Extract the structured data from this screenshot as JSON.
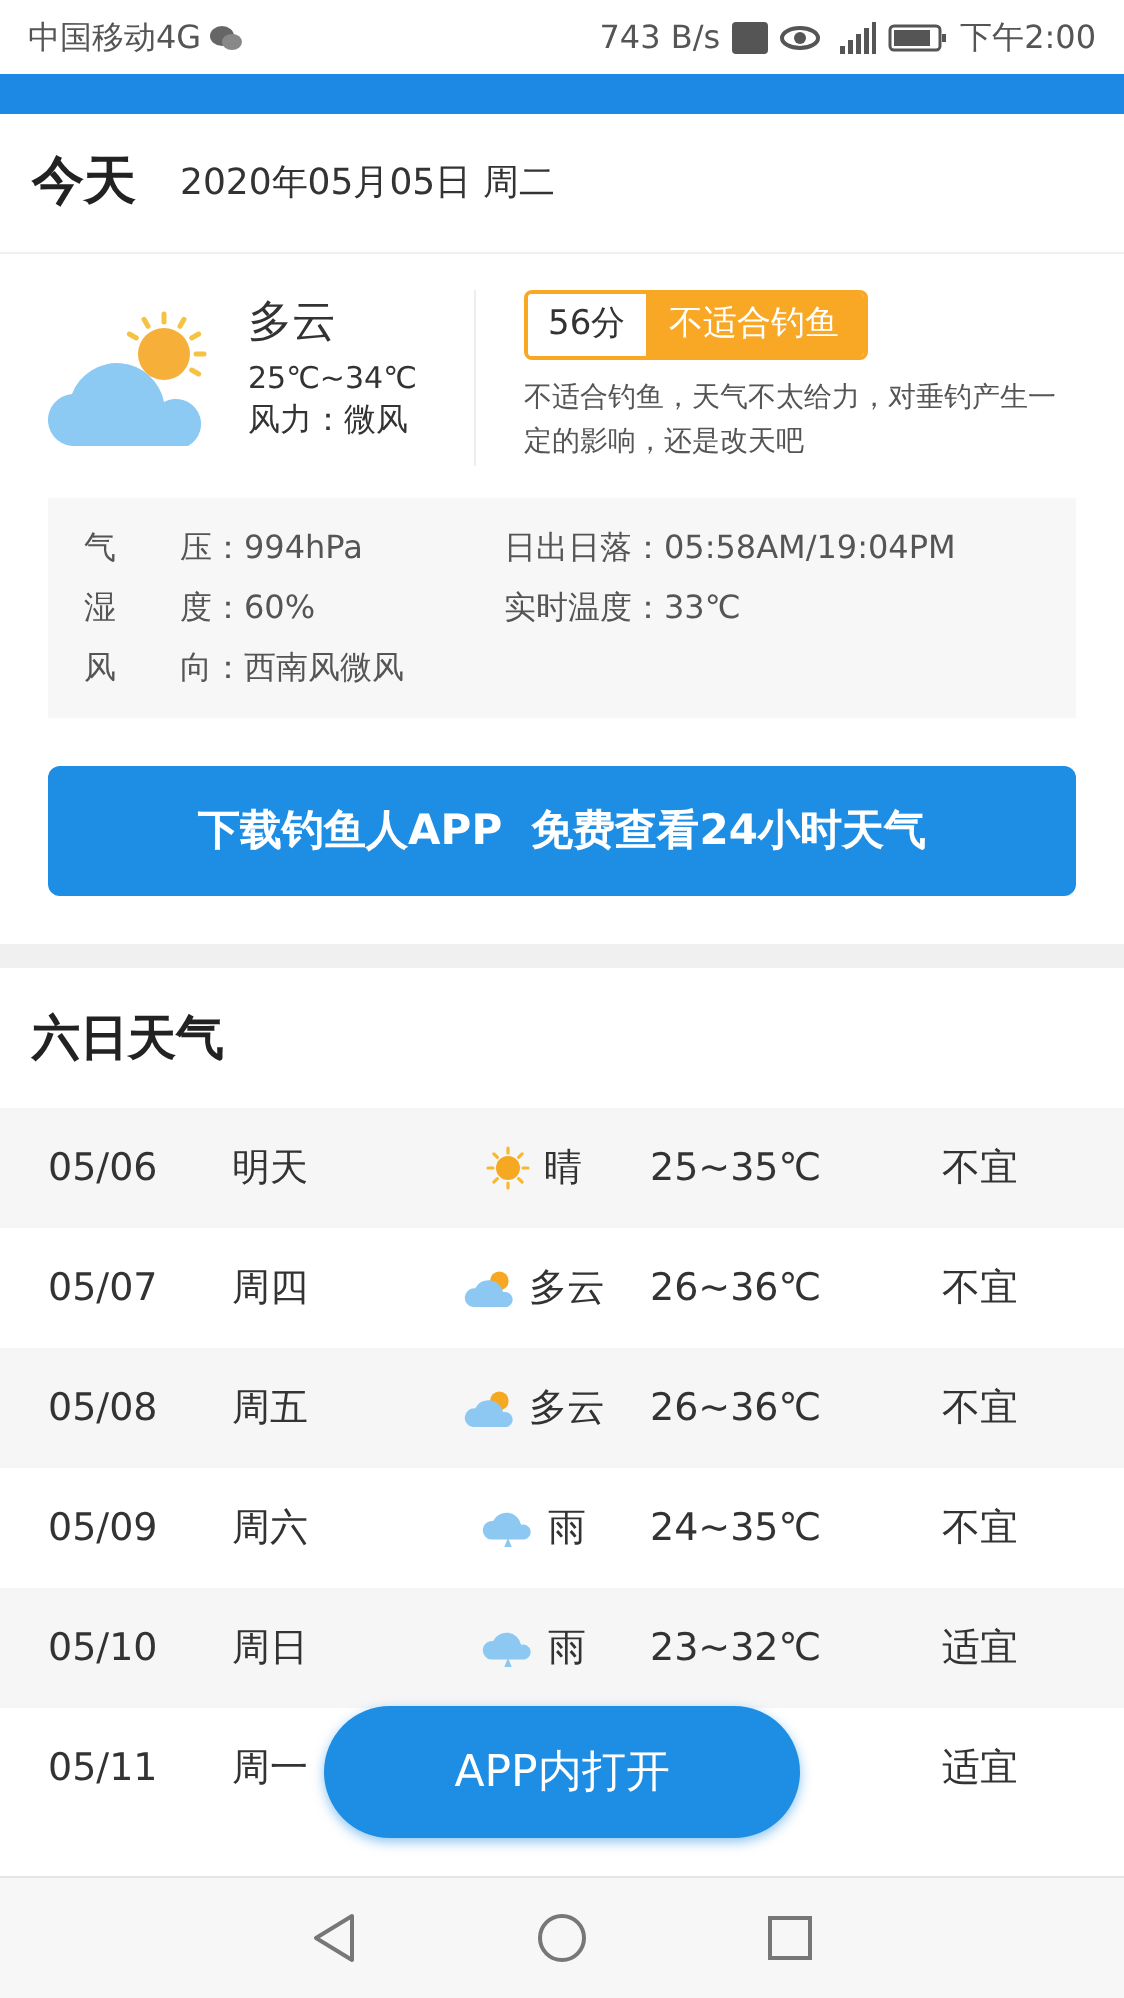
{
  "status_bar": {
    "carrier": "中国移动4G",
    "speed": "743 B/s",
    "time": "下午2:00"
  },
  "today": {
    "title": "今天",
    "date": "2020年05月05日 周二",
    "weather": "多云",
    "temp": "25℃~34℃",
    "wind": "风力：微风",
    "score": "56分",
    "verdict": "不适合钓鱼",
    "advice": "不适合钓鱼，天气不太给力，对垂钓产生一定的影响，还是改天吧",
    "details": [
      {
        "label": "气　　压：",
        "value": "994hPa"
      },
      {
        "label": "日出日落：",
        "value": "05:58AM/19:04PM"
      },
      {
        "label": "湿　　度：",
        "value": "60%"
      },
      {
        "label": "实时温度：",
        "value": "33℃"
      },
      {
        "label": "风　　向：",
        "value": "西南风微风"
      }
    ],
    "download_button": "下载钓鱼人APP  免费查看24小时天气"
  },
  "forecast": {
    "title": "六日天气",
    "rows": [
      {
        "date": "05/06",
        "day": "明天",
        "kind": "sunny",
        "weather": "晴",
        "temp": "25~35℃",
        "fishing": "不宜"
      },
      {
        "date": "05/07",
        "day": "周四",
        "kind": "cloudy",
        "weather": "多云",
        "temp": "26~36℃",
        "fishing": "不宜"
      },
      {
        "date": "05/08",
        "day": "周五",
        "kind": "cloudy",
        "weather": "多云",
        "temp": "26~36℃",
        "fishing": "不宜"
      },
      {
        "date": "05/09",
        "day": "周六",
        "kind": "rain",
        "weather": "雨",
        "temp": "24~35℃",
        "fishing": "不宜"
      },
      {
        "date": "05/10",
        "day": "周日",
        "kind": "rain",
        "weather": "雨",
        "temp": "23~32℃",
        "fishing": "适宜"
      },
      {
        "date": "05/11",
        "day": "周一",
        "kind": "hidden",
        "fishing": "适宜"
      }
    ]
  },
  "open_in_app_button": "APP内打开"
}
